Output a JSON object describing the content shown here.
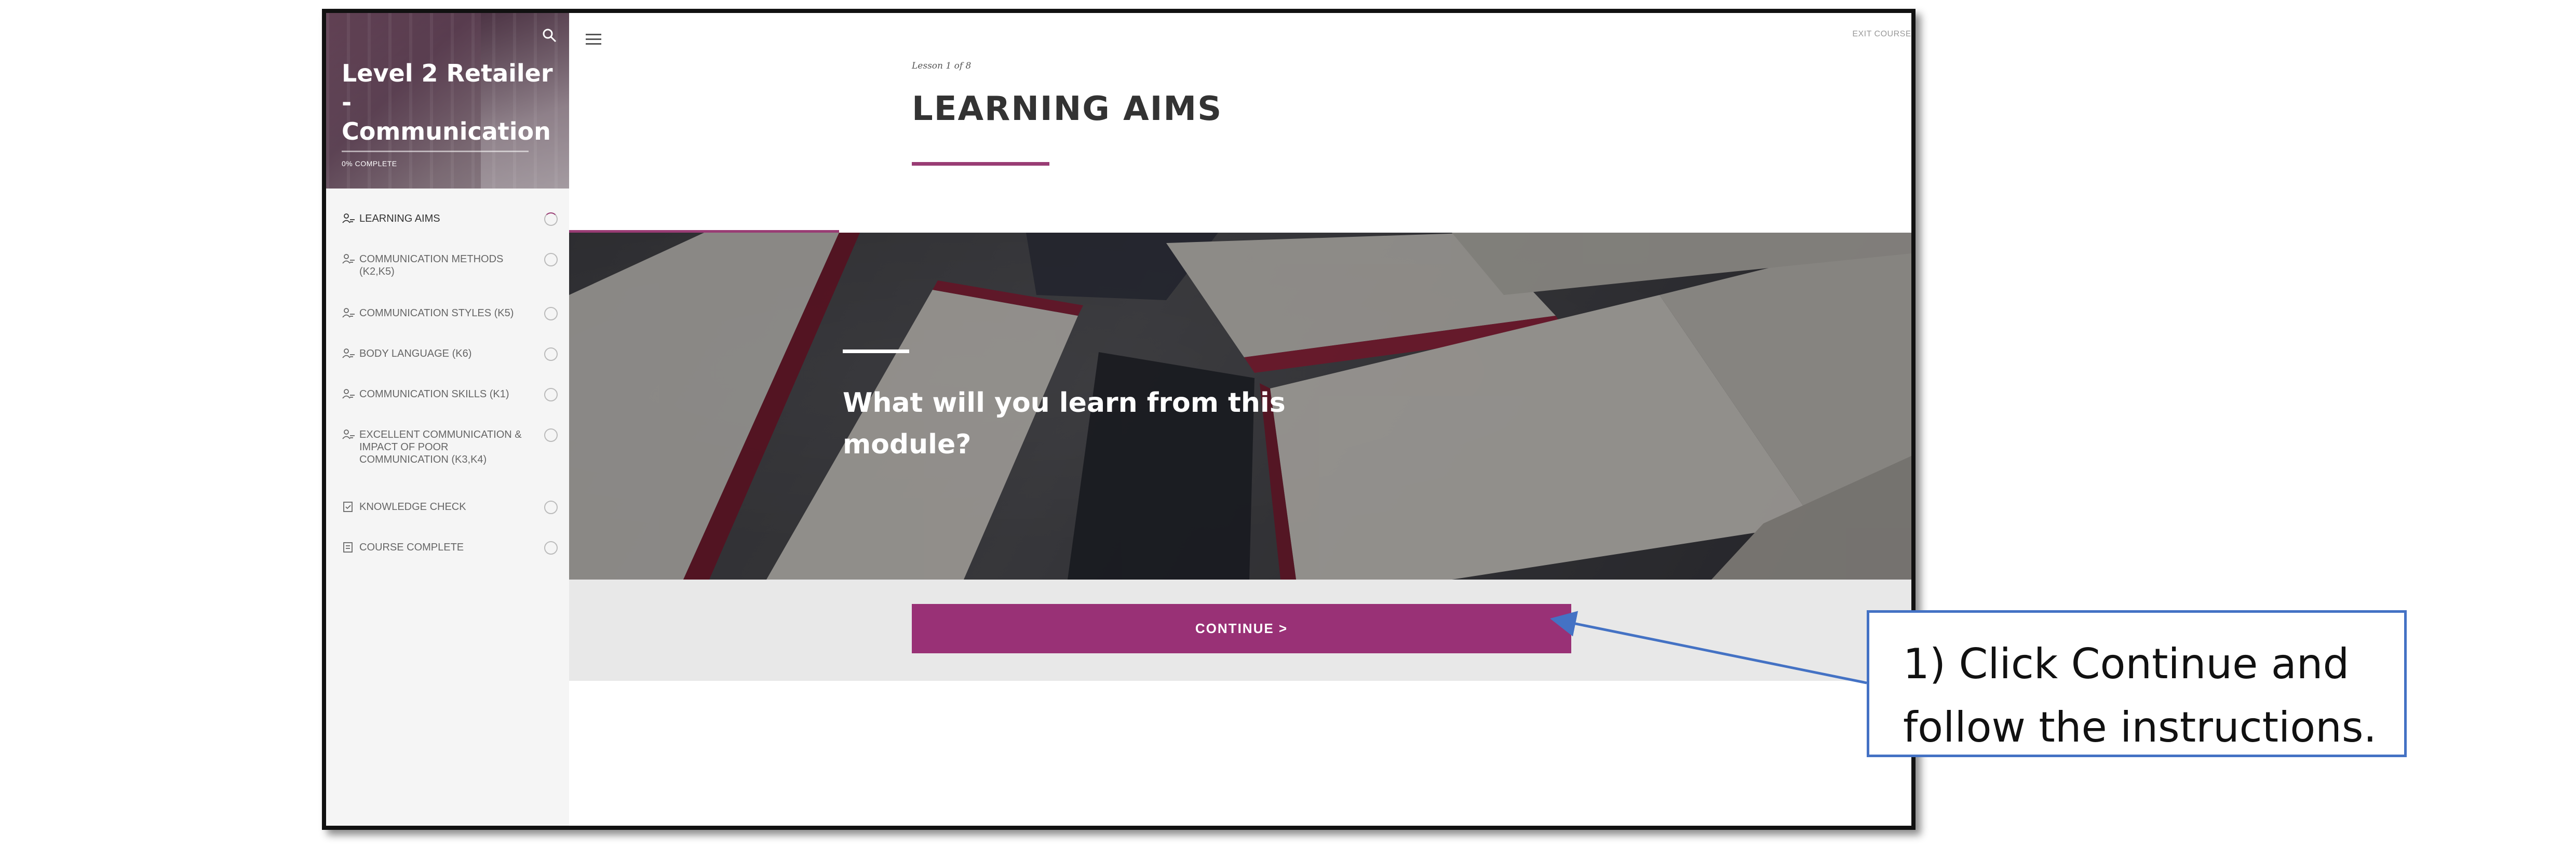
{
  "sidebar": {
    "course_title": "Level 2 Retailer - Communication",
    "progress_label": "0% COMPLETE",
    "progress_fraction": 0,
    "items": [
      {
        "label": "LEARNING AIMS",
        "active": true
      },
      {
        "label": "COMMUNICATION METHODS (K2,K5)"
      },
      {
        "label": "COMMUNICATION STYLES (K5)"
      },
      {
        "label": "BODY LANGUAGE (K6)"
      },
      {
        "label": "COMMUNICATION SKILLS (K1)"
      },
      {
        "label": "EXCELLENT COMMUNICATION & IMPACT OF POOR COMMUNICATION (K3,K4)"
      },
      {
        "label": "KNOWLEDGE CHECK"
      },
      {
        "label": "COURSE COMPLETE"
      }
    ]
  },
  "header": {
    "exit_label": "EXIT COURSE"
  },
  "lesson": {
    "counter": "Lesson 1 of 8",
    "title": "LEARNING AIMS",
    "hero_heading": "What will you learn from this module?",
    "continue_label": "CONTINUE >"
  },
  "callout": {
    "text": "1) Click Continue and follow the instructions."
  },
  "colors": {
    "accent": "#993176",
    "callout_border": "#4472c4"
  }
}
